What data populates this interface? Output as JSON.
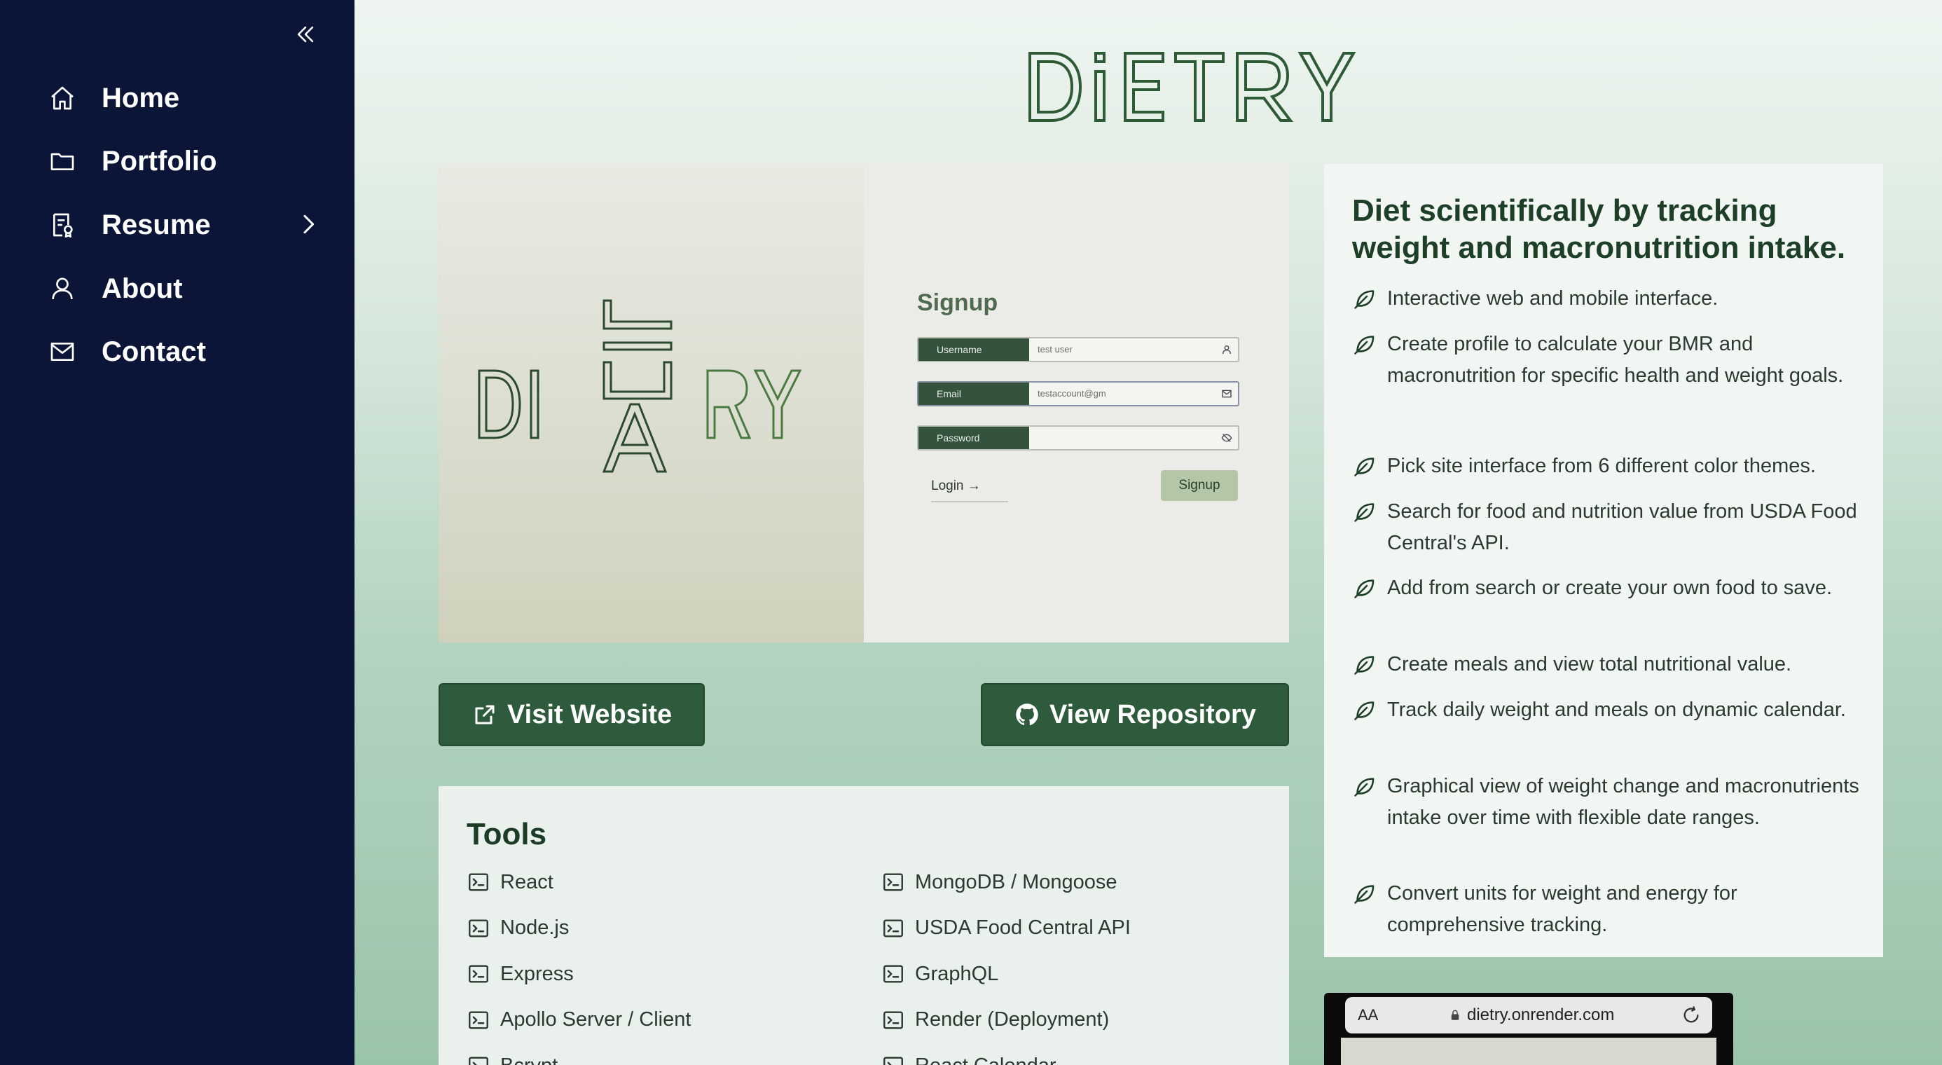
{
  "sidebar": {
    "collapse_icon": "double-chevron-left-icon",
    "items": [
      {
        "label": "Home",
        "icon": "home-icon"
      },
      {
        "label": "Portfolio",
        "icon": "folder-icon"
      },
      {
        "label": "Resume",
        "icon": "resume-icon",
        "expandable": true
      },
      {
        "label": "About",
        "icon": "user-icon"
      },
      {
        "label": "Contact",
        "icon": "mail-icon"
      }
    ]
  },
  "project": {
    "logo_text": "DiETRY",
    "preview": {
      "logo_text": "DIETARY",
      "signup_title": "Signup",
      "fields": [
        {
          "label": "Username",
          "value": "test user",
          "icon": "user-icon"
        },
        {
          "label": "Email",
          "value": "testaccount@gm",
          "icon": "mail-icon"
        },
        {
          "label": "Password",
          "value": "",
          "icon": "eye-off-icon"
        }
      ],
      "login_link": "Login",
      "signup_button": "Signup"
    },
    "visit_button": "Visit Website",
    "repo_button": "View Repository",
    "tools_title": "Tools",
    "tools": [
      "React",
      "MongoDB / Mongoose",
      "Node.js",
      "USDA Food Central API",
      "Express",
      "GraphQL",
      "Apollo Server / Client",
      "Render (Deployment)",
      "Bcrypt",
      "React Calendar"
    ],
    "tagline": "Diet scientifically by tracking weight and macronutrition intake.",
    "features": [
      "Interactive web and mobile interface.",
      "Create profile to calculate your BMR and macronutrition for specific health and weight goals.",
      "Pick site interface from 6 different color themes.",
      "Search for food and nutrition value from USDA Food Central's API.",
      "Add from search or create your own food to save.",
      "Create meals and view total nutritional value.",
      "Track daily weight and meals on dynamic calendar.",
      "Graphical view of weight change and macronutrients intake over time with flexible date ranges.",
      "Convert units for weight and energy for comprehensive tracking."
    ],
    "phone_preview": {
      "text_size": "AA",
      "url": "dietry.onrender.com"
    }
  },
  "colors": {
    "sidebar_bg": "#0b1538",
    "accent_green": "#2d5b3b",
    "heading_green": "#1e3f27"
  }
}
